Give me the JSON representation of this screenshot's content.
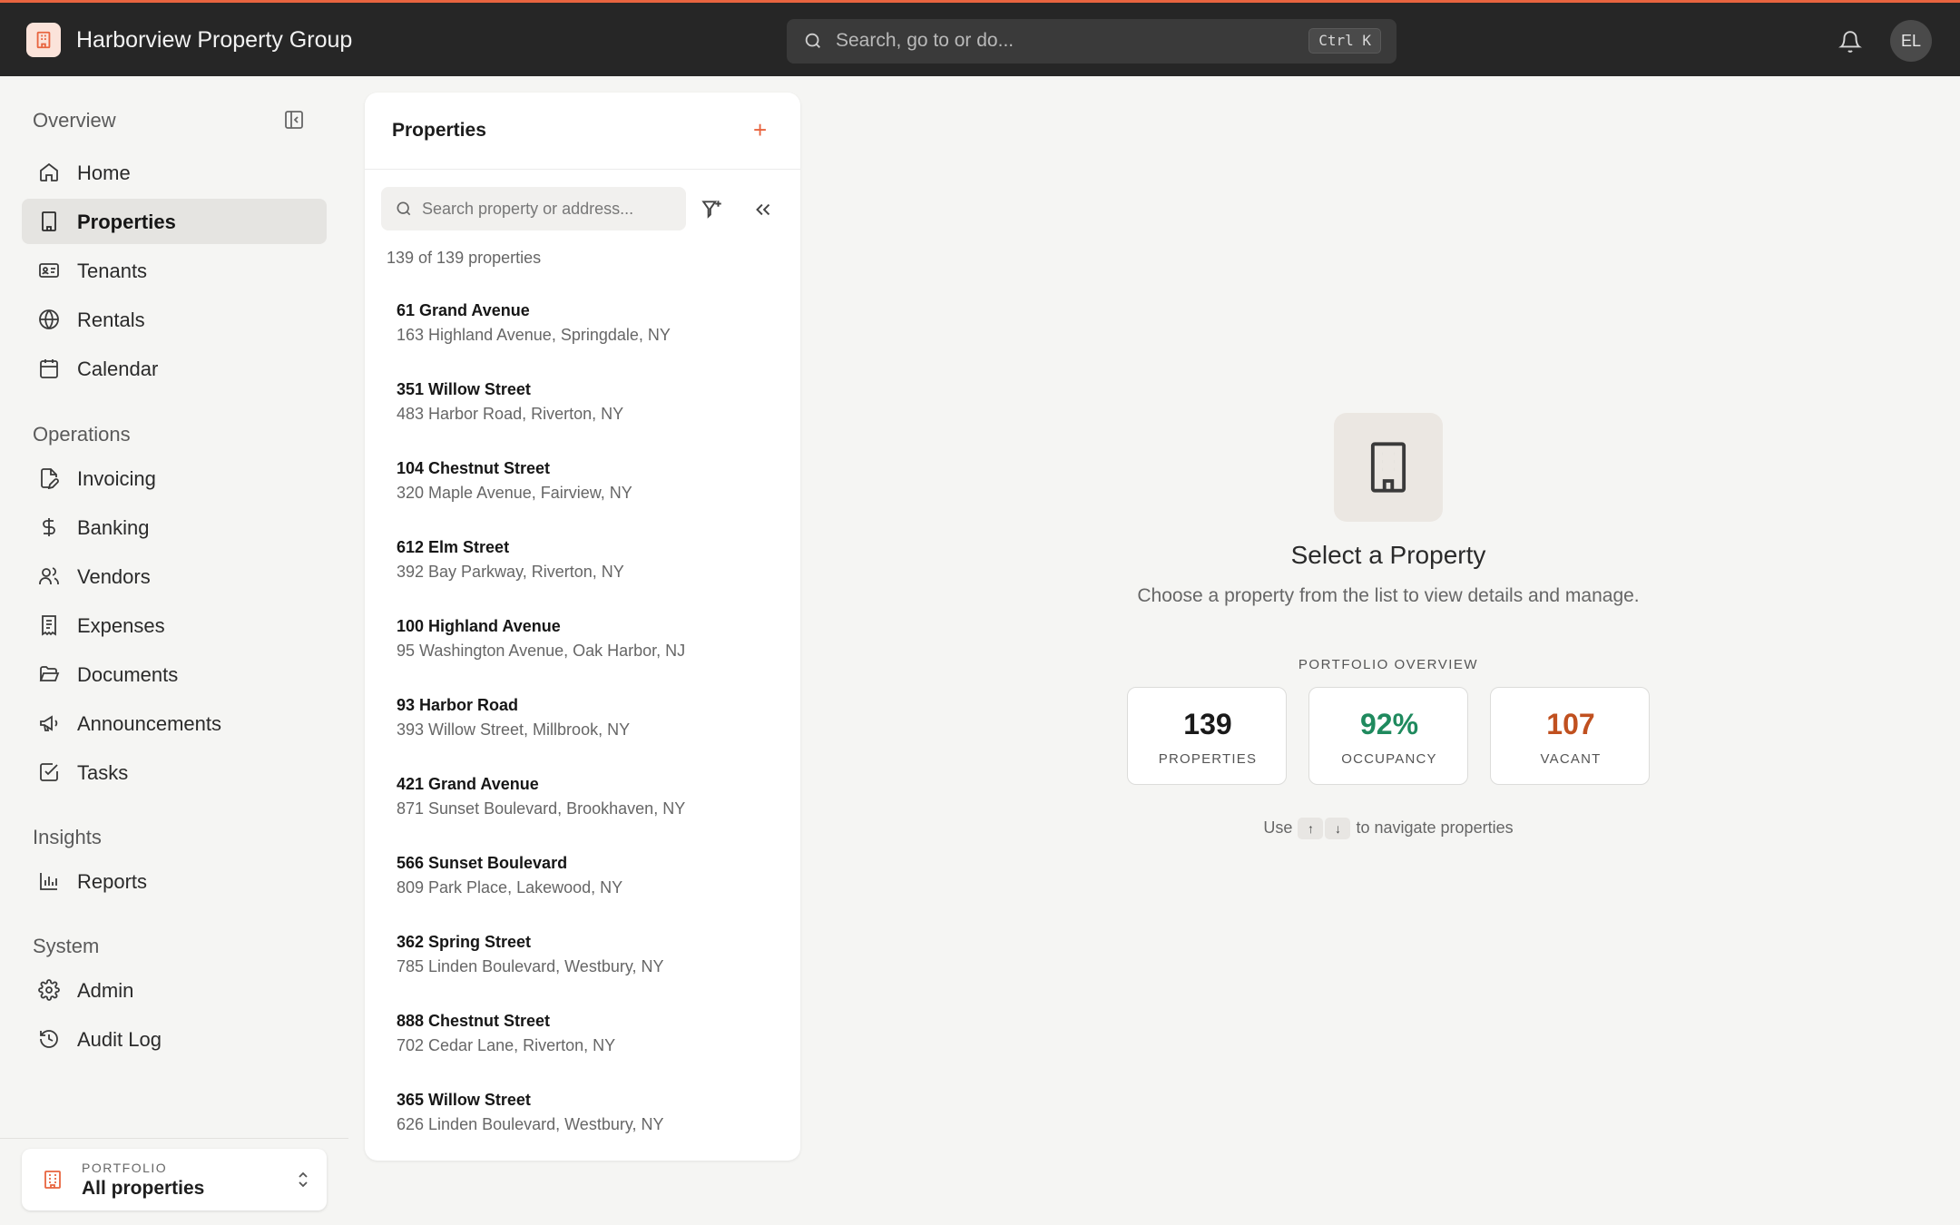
{
  "header": {
    "app_name": "Harborview Property Group",
    "search_placeholder": "Search, go to or do...",
    "search_shortcut": "Ctrl K",
    "avatar_initials": "EL",
    "accent_color": "#e8643f"
  },
  "sidebar": {
    "sections": {
      "overview": "Overview",
      "operations": "Operations",
      "insights": "Insights",
      "system": "System"
    },
    "items": [
      {
        "label": "Home",
        "icon": "home-icon"
      },
      {
        "label": "Properties",
        "icon": "building-icon",
        "active": true
      },
      {
        "label": "Tenants",
        "icon": "id-card-icon"
      },
      {
        "label": "Rentals",
        "icon": "globe-icon"
      },
      {
        "label": "Calendar",
        "icon": "calendar-icon"
      },
      {
        "label": "Invoicing",
        "icon": "file-pen-icon"
      },
      {
        "label": "Banking",
        "icon": "dollar-icon"
      },
      {
        "label": "Vendors",
        "icon": "users-icon"
      },
      {
        "label": "Expenses",
        "icon": "receipt-icon"
      },
      {
        "label": "Documents",
        "icon": "folder-open-icon"
      },
      {
        "label": "Announcements",
        "icon": "megaphone-icon"
      },
      {
        "label": "Tasks",
        "icon": "check-square-icon"
      },
      {
        "label": "Reports",
        "icon": "bar-chart-icon"
      },
      {
        "label": "Admin",
        "icon": "gear-icon"
      },
      {
        "label": "Audit Log",
        "icon": "history-icon"
      }
    ],
    "portfolio": {
      "label": "PORTFOLIO",
      "value": "All properties"
    }
  },
  "properties_panel": {
    "title": "Properties",
    "add_symbol": "+",
    "search_placeholder": "Search property or address...",
    "count_text": "139 of 139 properties",
    "list": [
      {
        "name": "61 Grand Avenue",
        "address": "163 Highland Avenue, Springdale, NY"
      },
      {
        "name": "351 Willow Street",
        "address": "483 Harbor Road, Riverton, NY"
      },
      {
        "name": "104 Chestnut Street",
        "address": "320 Maple Avenue, Fairview, NY"
      },
      {
        "name": "612 Elm Street",
        "address": "392 Bay Parkway, Riverton, NY"
      },
      {
        "name": "100 Highland Avenue",
        "address": "95 Washington Avenue, Oak Harbor, NJ"
      },
      {
        "name": "93 Harbor Road",
        "address": "393 Willow Street, Millbrook, NY"
      },
      {
        "name": "421 Grand Avenue",
        "address": "871 Sunset Boulevard, Brookhaven, NY"
      },
      {
        "name": "566 Sunset Boulevard",
        "address": "809 Park Place, Lakewood, NY"
      },
      {
        "name": "362 Spring Street",
        "address": "785 Linden Boulevard, Westbury, NY"
      },
      {
        "name": "888 Chestnut Street",
        "address": "702 Cedar Lane, Riverton, NY"
      },
      {
        "name": "365 Willow Street",
        "address": "626 Linden Boulevard, Westbury, NY"
      }
    ]
  },
  "empty_state": {
    "title": "Select a Property",
    "subtitle": "Choose a property from the list to view details and manage.",
    "overview_label": "PORTFOLIO OVERVIEW",
    "stats": [
      {
        "value": "139",
        "label": "PROPERTIES",
        "color": "#1a1a1a"
      },
      {
        "value": "92%",
        "label": "OCCUPANCY",
        "color": "#1f8a5e"
      },
      {
        "value": "107",
        "label": "VACANT",
        "color": "#c0501f"
      }
    ],
    "hint_prefix": "Use",
    "hint_key_up": "↑",
    "hint_key_down": "↓",
    "hint_suffix": "to navigate properties"
  }
}
